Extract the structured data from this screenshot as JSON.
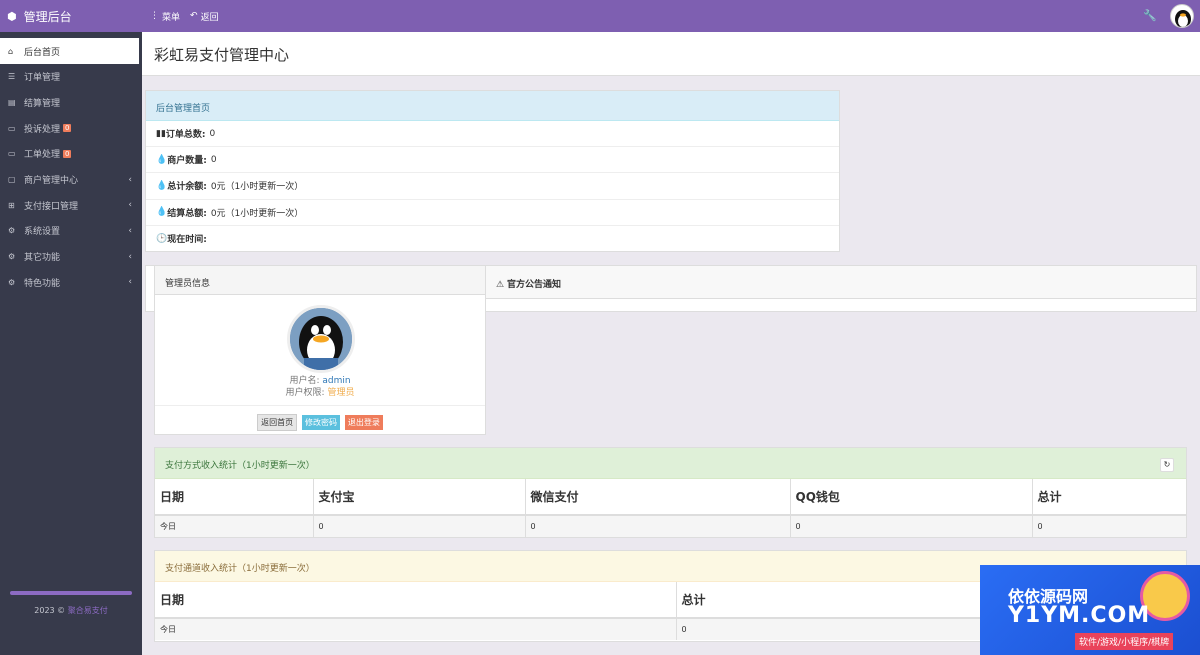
{
  "topbar": {
    "brand": "管理后台",
    "menu": "菜单",
    "back": "返回"
  },
  "sidebar": {
    "items": [
      {
        "label": "后台首页",
        "icon": "home-icon"
      },
      {
        "label": "订单管理",
        "icon": "list-icon"
      },
      {
        "label": "结算管理",
        "icon": "book-icon"
      },
      {
        "label": "投诉处理",
        "icon": "file-icon",
        "badge": "0"
      },
      {
        "label": "工单处理",
        "icon": "file-icon",
        "badge": "0"
      },
      {
        "label": "商户管理中心",
        "icon": "folder-icon"
      },
      {
        "label": "支付接口管理",
        "icon": "grid-icon"
      },
      {
        "label": "系统设置",
        "icon": "gear-icon"
      },
      {
        "label": "其它功能",
        "icon": "gears-icon"
      },
      {
        "label": "特色功能",
        "icon": "gears-icon"
      }
    ],
    "footer_year": "2023 ©",
    "footer_link": "聚合易支付"
  },
  "page": {
    "title": "彩虹易支付管理中心"
  },
  "stats": {
    "title": "后台管理首页",
    "rows": [
      {
        "label": "订单总数:",
        "value": "0"
      },
      {
        "label": "商户数量:",
        "value": "0"
      },
      {
        "label": "总计余额:",
        "value": "0元（1小时更新一次）"
      },
      {
        "label": "结算总额:",
        "value": "0元（1小时更新一次）"
      },
      {
        "label": "现在时间:",
        "value": ""
      }
    ]
  },
  "admin": {
    "title": "管理员信息",
    "username_label": "用户名:",
    "username": "admin",
    "role_label": "用户权限:",
    "role": "管理员",
    "btn_home": "返回首页",
    "btn_pwd": "修改密码",
    "btn_logout": "退出登录"
  },
  "notice": {
    "title": "官方公告通知"
  },
  "pay_method": {
    "title": "支付方式收入统计（1小时更新一次）",
    "headers": [
      "日期",
      "支付宝",
      "微信支付",
      "QQ钱包",
      "总计"
    ],
    "row": [
      "今日",
      "0",
      "0",
      "0",
      "0"
    ]
  },
  "pay_channel": {
    "title": "支付通道收入统计（1小时更新一次）",
    "headers": [
      "日期",
      "总计"
    ],
    "row": [
      "今日",
      "0"
    ]
  },
  "watermark": {
    "line1": "依依源码网",
    "line2": "Y1YM.COM",
    "line3": "软件/游戏/小程序/棋牌"
  }
}
